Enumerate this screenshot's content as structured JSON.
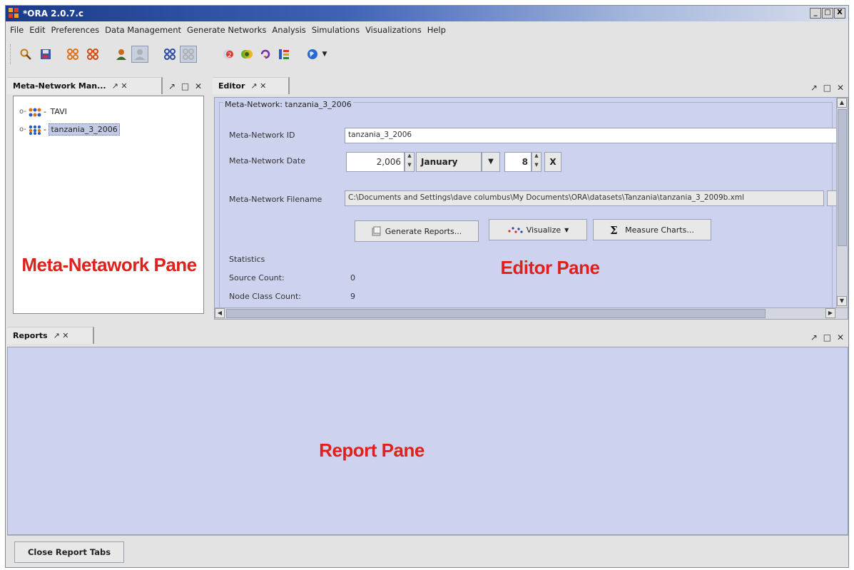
{
  "window": {
    "title": "*ORA 2.0.7.c",
    "controls": [
      "_",
      "□",
      "X"
    ]
  },
  "menu": [
    "File",
    "Edit",
    "Preferences",
    "Data Management",
    "Generate Networks",
    "Analysis",
    "Simulations",
    "Visualizations",
    "Help"
  ],
  "toolbar": {
    "icons": [
      "open-icon",
      "save-icon",
      "network-icon",
      "network-alt-icon",
      "user-icon",
      "user-disabled-icon",
      "graph-icon",
      "graph-disabled-icon",
      "measures-icon",
      "venn-icon",
      "cycle-icon",
      "hierarchy-icon",
      "globe-icon",
      "dropdown-icon"
    ]
  },
  "meta_pane": {
    "tab_label": "Meta-Network Man...",
    "tab_controls": "↗ ✕",
    "pane_controls": "↗ □ ✕",
    "tree": [
      {
        "label": "TAVI",
        "selected": false
      },
      {
        "label": "tanzania_3_2006",
        "selected": true
      }
    ],
    "overlay": "Meta-Netawork Pane"
  },
  "editor_pane": {
    "tab_label": "Editor",
    "tab_controls": "↗ ✕",
    "pane_controls": "↗ □ ✕",
    "group_title": "Meta-Network: tanzania_3_2006",
    "id_label": "Meta-Network ID",
    "id_value": "tanzania_3_2006",
    "date_label": "Meta-Network Date",
    "year_value": "2,006",
    "month_value": "January",
    "day_value": "8",
    "clear_label": "X",
    "filename_label": "Meta-Network Filename",
    "filename_value": "C:\\Documents and Settings\\dave columbus\\My Documents\\ORA\\datasets\\Tanzania\\tanzania_3_2009b.xml",
    "buttons": {
      "generate_reports": "Generate Reports...",
      "visualize": "Visualize",
      "measure_charts": "Measure Charts..."
    },
    "statistics_label": "Statistics",
    "source_count_label": "Source Count:",
    "source_count_value": "0",
    "node_class_count_label": "Node Class Count:",
    "node_class_count_value": "9",
    "overlay": "Editor Pane"
  },
  "reports_pane": {
    "tab_label": "Reports",
    "tab_controls": "↗ ✕",
    "pane_controls": "↗ □ ✕",
    "overlay": "Report Pane",
    "close_button": "Close Report Tabs"
  },
  "colors": {
    "overlay_red": "#e0201c",
    "pane_bg": "#cdd3ee",
    "title_blue": "#1a3a8a"
  }
}
